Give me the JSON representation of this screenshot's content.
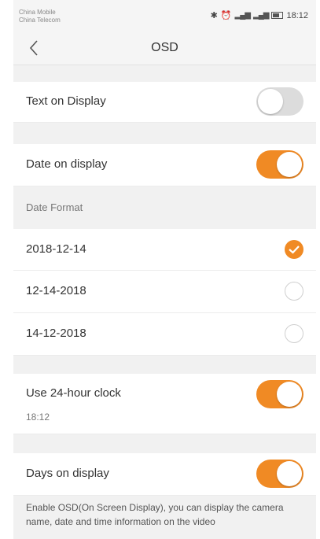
{
  "status_bar": {
    "carrier_1": "China Mobile",
    "carrier_2": "China Telecom",
    "time": "18:12"
  },
  "header": {
    "title": "OSD",
    "back_icon": "chevron-left-icon"
  },
  "settings": {
    "text_on_display": {
      "label": "Text on Display",
      "enabled": false
    },
    "date_on_display": {
      "label": "Date on display",
      "enabled": true
    },
    "date_format": {
      "header": "Date Format",
      "options": [
        "2018-12-14",
        "12-14-2018",
        "14-12-2018"
      ],
      "selected_index": 0
    },
    "use_24_hour_clock": {
      "label": "Use 24-hour clock",
      "preview": "18:12",
      "enabled": true
    },
    "days_on_display": {
      "label": "Days on display",
      "enabled": true
    },
    "description": "Enable OSD(On Screen Display), you can display the camera name, date and time information on the video"
  },
  "colors": {
    "accent": "#f08a24",
    "toggle_off": "#dcdcdc",
    "background": "#f1f1f1"
  }
}
